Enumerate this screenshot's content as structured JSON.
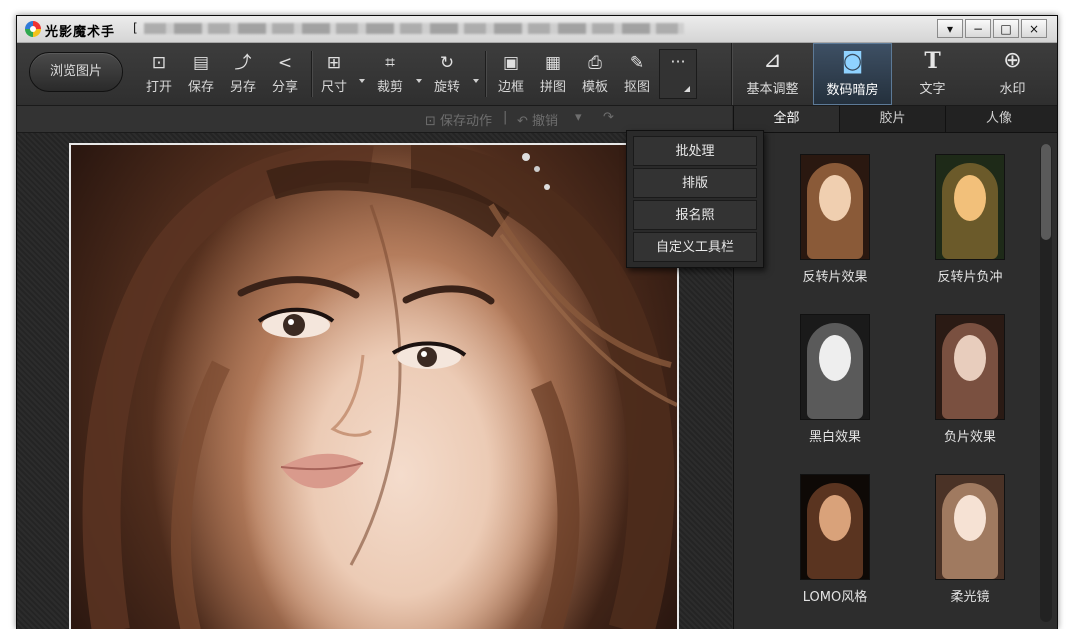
{
  "window": {
    "app_title": "光影魔术手",
    "doc_path_prefix": "[",
    "controls": [
      "▾",
      "−",
      "□",
      "×"
    ]
  },
  "toolbar": {
    "browse_label": "浏览图片",
    "tools": [
      {
        "name": "open",
        "icon": "image-open-icon",
        "glyph": "⊡",
        "label": "打开"
      },
      {
        "name": "save",
        "icon": "floppy-icon",
        "glyph": "▤",
        "label": "保存"
      },
      {
        "name": "save-as",
        "icon": "save-as-icon",
        "glyph": "⤴",
        "label": "另存"
      },
      {
        "name": "share",
        "icon": "share-icon",
        "glyph": "<",
        "label": "分享"
      },
      {
        "name": "size",
        "icon": "resize-icon",
        "glyph": "⊞",
        "label": "尺寸"
      },
      {
        "name": "crop",
        "icon": "crop-icon",
        "glyph": "⌗",
        "label": "裁剪"
      },
      {
        "name": "rotate",
        "icon": "rotate-icon",
        "glyph": "↻",
        "label": "旋转"
      },
      {
        "name": "border",
        "icon": "frame-icon",
        "glyph": "▣",
        "label": "边框"
      },
      {
        "name": "collage",
        "icon": "collage-icon",
        "glyph": "▦",
        "label": "拼图"
      },
      {
        "name": "template",
        "icon": "printer-icon",
        "glyph": "⎙",
        "label": "模板"
      },
      {
        "name": "cutout",
        "icon": "pin-icon",
        "glyph": "✎",
        "label": "抠图"
      }
    ],
    "more_glyph": "···"
  },
  "modes": [
    {
      "icon": "adjust-icon",
      "glyph": "⊿",
      "label": "基本调整"
    },
    {
      "icon": "camera-icon",
      "glyph": "◙",
      "label": "数码暗房"
    },
    {
      "icon": "text-icon",
      "glyph": "T",
      "label": "文字"
    },
    {
      "icon": "watermark-icon",
      "glyph": "⊕",
      "label": "水印"
    }
  ],
  "subbar": {
    "save_action": "保存动作",
    "undo": "撤销"
  },
  "more_menu": [
    "批处理",
    "排版",
    "报名照",
    "自定义工具栏"
  ],
  "panel_tabs": [
    "全部",
    "胶片",
    "人像"
  ],
  "effects": [
    {
      "label": "反转片效果"
    },
    {
      "label": "反转片负冲"
    },
    {
      "label": "黑白效果"
    },
    {
      "label": "负片效果"
    },
    {
      "label": "LOMO风格"
    },
    {
      "label": "柔光镜"
    }
  ],
  "colors": {
    "accent": "#8fd2ff",
    "panel_bg": "#2d2d2d",
    "toolbar_bg": "#3a3a3a"
  }
}
